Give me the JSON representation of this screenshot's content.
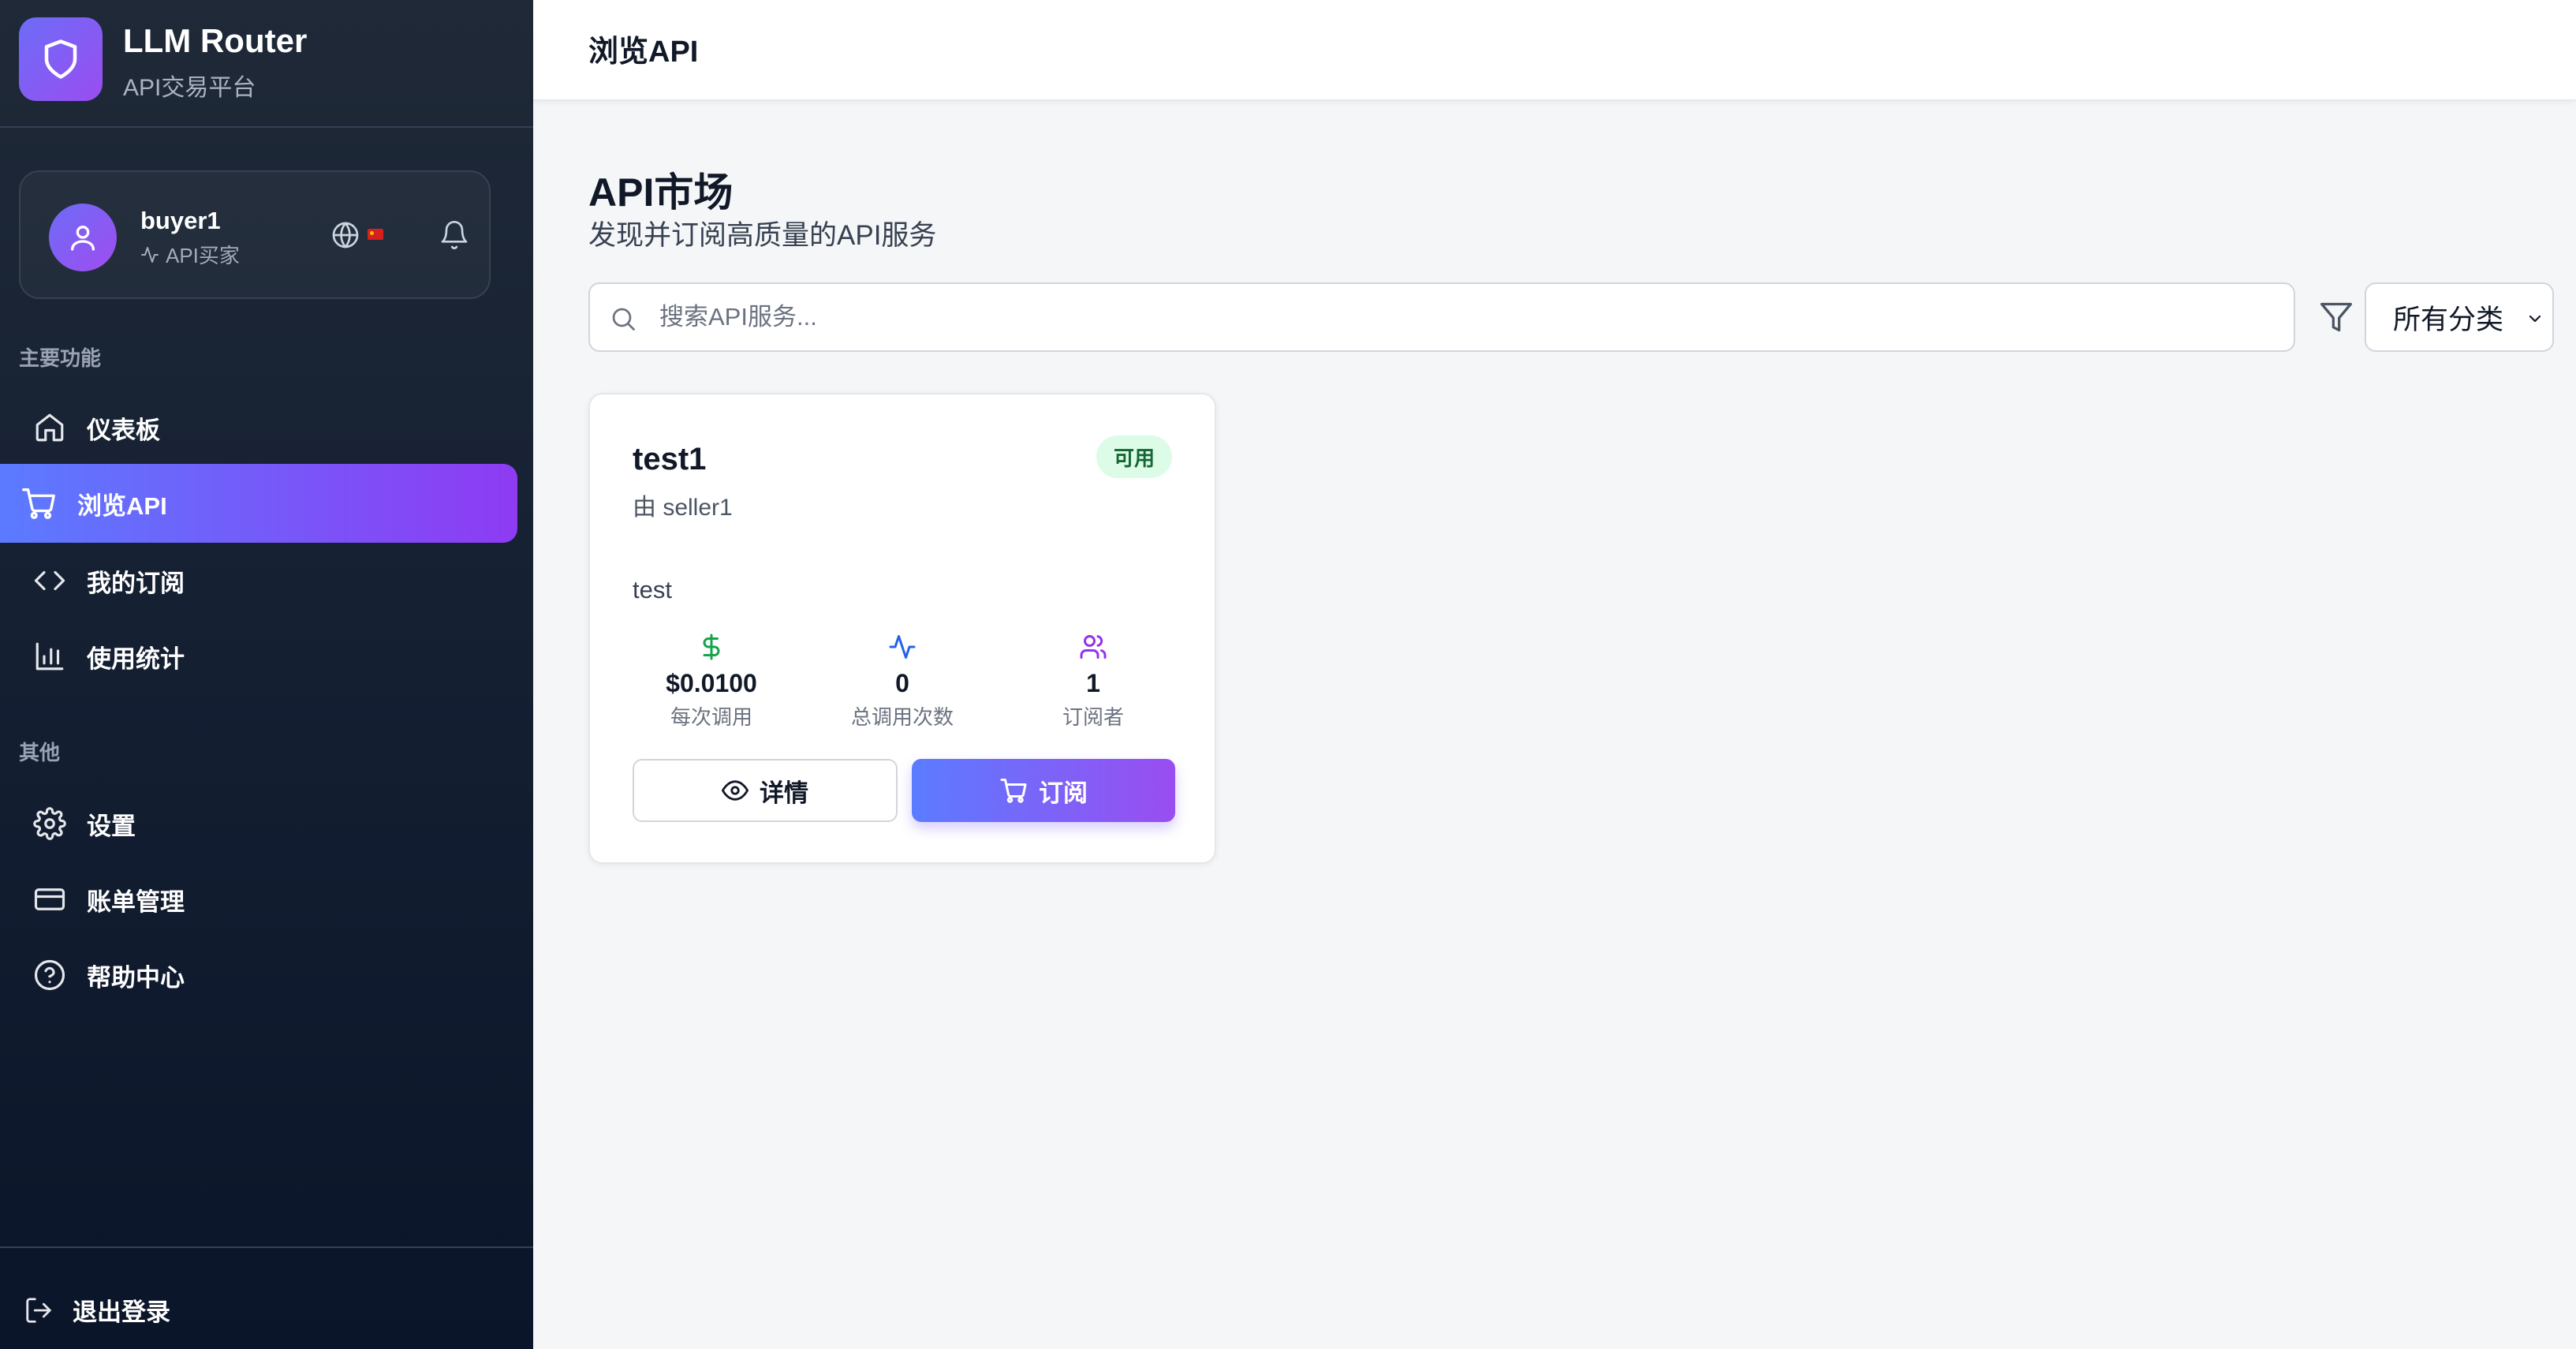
{
  "brand": {
    "title": "LLM Router",
    "subtitle": "API交易平台"
  },
  "user": {
    "name": "buyer1",
    "role": "API买家"
  },
  "sidebar": {
    "main_label": "主要功能",
    "main_items": [
      {
        "label": "仪表板",
        "icon": "home-icon"
      },
      {
        "label": "浏览API",
        "icon": "cart-icon",
        "active": true
      },
      {
        "label": "我的订阅",
        "icon": "code-icon"
      },
      {
        "label": "使用统计",
        "icon": "bar-chart-icon"
      }
    ],
    "other_label": "其他",
    "other_items": [
      {
        "label": "设置",
        "icon": "gear-icon"
      },
      {
        "label": "账单管理",
        "icon": "credit-card-icon"
      },
      {
        "label": "帮助中心",
        "icon": "help-icon"
      }
    ],
    "logout": "退出登录"
  },
  "topbar": {
    "title": "浏览API"
  },
  "main": {
    "title": "API市场",
    "subtitle": "发现并订阅高质量的API服务",
    "search_placeholder": "搜索API服务...",
    "category_select": "所有分类"
  },
  "api_card": {
    "name": "test1",
    "seller": "由 seller1",
    "status": "可用",
    "description": "test",
    "stats": [
      {
        "value": "$0.0100",
        "label": "每次调用",
        "icon": "dollar-icon",
        "color": "#16a34a"
      },
      {
        "value": "0",
        "label": "总调用次数",
        "icon": "activity-icon",
        "color": "#2563eb"
      },
      {
        "value": "1",
        "label": "订阅者",
        "icon": "users-icon",
        "color": "#9333ea"
      }
    ],
    "detail_button": "详情",
    "subscribe_button": "订阅"
  },
  "colors": {
    "accent_start": "#5b7bff",
    "accent_end": "#8e3bf3",
    "sidebar_bg": "#111827",
    "success_bg": "#dcfce7",
    "success_text": "#166534"
  }
}
